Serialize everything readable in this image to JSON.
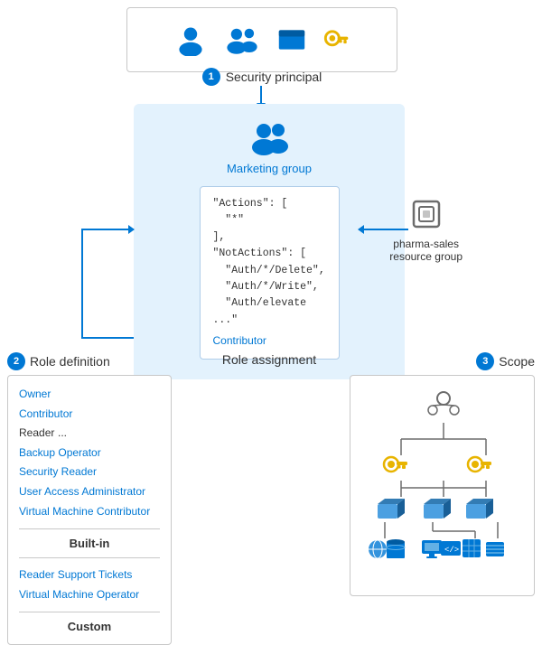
{
  "security_principal": {
    "label": "Security principal",
    "number": "1"
  },
  "role_definition": {
    "label": "Role definition",
    "number": "2",
    "built_in_label": "Built-in",
    "custom_label": "Custom",
    "items_builtin": [
      "Owner",
      "Contributor",
      "Reader",
      "...",
      "Backup Operator",
      "Security Reader",
      "User Access Administrator",
      "Virtual Machine Contributor"
    ],
    "items_custom": [
      "Reader Support Tickets",
      "Virtual Machine Operator"
    ]
  },
  "role_assignment": {
    "label": "Role assignment",
    "group_name": "Marketing group",
    "contributor_label": "Contributor",
    "actions_code": "\"Actions\": [\n  \"*\"\n],\n\"NotActions\": [\n  \"Auth/*/Delete\",\n  \"Auth/*/Write\",\n  \"Auth/elevate ...\""
  },
  "scope": {
    "label": "Scope",
    "number": "3"
  },
  "resource_group": {
    "label": "pharma-sales\nresource group"
  }
}
